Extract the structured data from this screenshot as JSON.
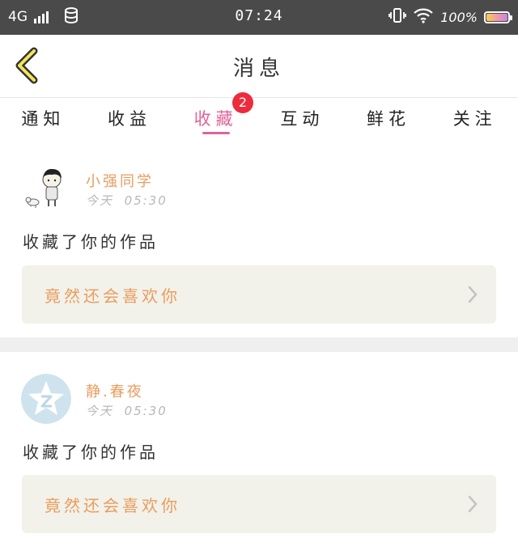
{
  "status_bar": {
    "network": "4G",
    "time": "07:24",
    "battery_percent": "100%"
  },
  "header": {
    "title": "消息"
  },
  "tabs": [
    {
      "label": "通知"
    },
    {
      "label": "收益"
    },
    {
      "label": "收藏",
      "active": true,
      "badge": "2"
    },
    {
      "label": "互动"
    },
    {
      "label": "鲜花"
    },
    {
      "label": "关注"
    }
  ],
  "messages": [
    {
      "user": "小强同学",
      "time_day": "今天",
      "time": "05:30",
      "action": "收藏了你的作品",
      "quote": "竟然还会喜欢你",
      "avatar_icon": "cartoon-boy-avatar"
    },
    {
      "user": "静.春夜",
      "time_day": "今天",
      "time": "05:30",
      "action": "收藏了你的作品",
      "quote": "竟然还会喜欢你",
      "avatar_icon": "default-avatar"
    }
  ],
  "colors": {
    "accent_pink": "#e2629a",
    "name_orange": "#e99c5e",
    "badge_red": "#ee2b3c",
    "status_bar": "#4a4a4a",
    "quote_bg": "#f2f2ea"
  }
}
